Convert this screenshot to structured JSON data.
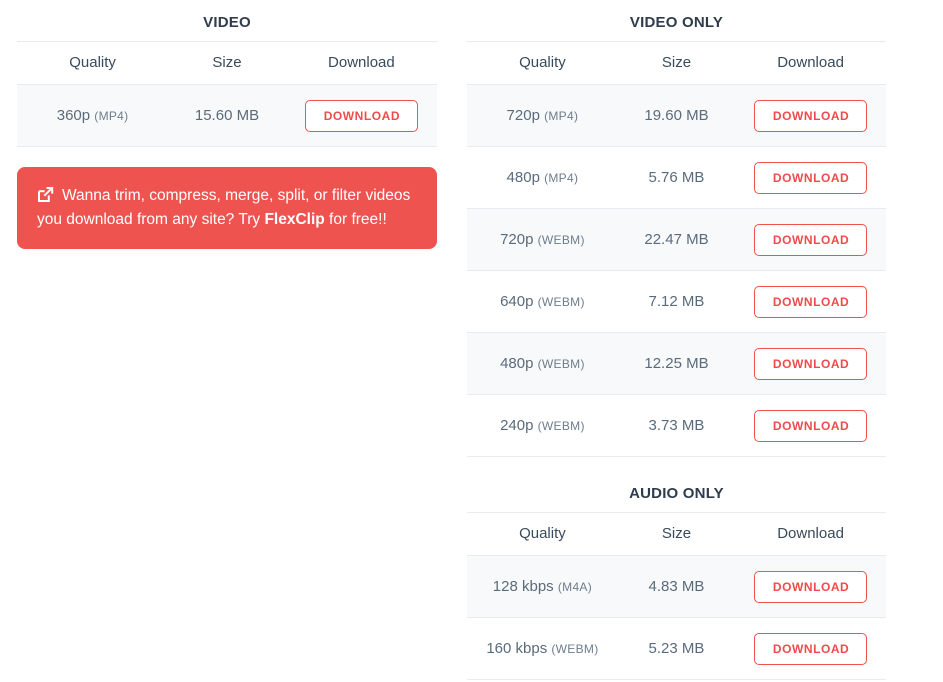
{
  "sections": {
    "video": {
      "title": "VIDEO",
      "columns": {
        "quality": "Quality",
        "size": "Size",
        "download": "Download"
      },
      "rows": [
        {
          "quality": "360p",
          "format": "(MP4)",
          "size": "15.60 MB",
          "button": "DOWNLOAD"
        }
      ]
    },
    "video_only": {
      "title": "VIDEO ONLY",
      "columns": {
        "quality": "Quality",
        "size": "Size",
        "download": "Download"
      },
      "rows": [
        {
          "quality": "720p",
          "format": "(MP4)",
          "size": "19.60 MB",
          "button": "DOWNLOAD"
        },
        {
          "quality": "480p",
          "format": "(MP4)",
          "size": "5.76 MB",
          "button": "DOWNLOAD"
        },
        {
          "quality": "720p",
          "format": "(WEBM)",
          "size": "22.47 MB",
          "button": "DOWNLOAD"
        },
        {
          "quality": "640p",
          "format": "(WEBM)",
          "size": "7.12 MB",
          "button": "DOWNLOAD"
        },
        {
          "quality": "480p",
          "format": "(WEBM)",
          "size": "12.25 MB",
          "button": "DOWNLOAD"
        },
        {
          "quality": "240p",
          "format": "(WEBM)",
          "size": "3.73 MB",
          "button": "DOWNLOAD"
        }
      ]
    },
    "audio_only": {
      "title": "AUDIO ONLY",
      "columns": {
        "quality": "Quality",
        "size": "Size",
        "download": "Download"
      },
      "rows": [
        {
          "quality": "128 kbps",
          "format": "(M4A)",
          "size": "4.83 MB",
          "button": "DOWNLOAD"
        },
        {
          "quality": "160 kbps",
          "format": "(WEBM)",
          "size": "5.23 MB",
          "button": "DOWNLOAD"
        }
      ]
    }
  },
  "promo": {
    "icon": "external-link-icon",
    "text_before": "Wanna trim, compress, merge, split, or filter videos you download from any site? Try ",
    "brand": "FlexClip",
    "text_after": " for free!!",
    "background_color": "#ef5350"
  },
  "colors": {
    "accent": "#ef4b4b",
    "heading": "#2f3c4c",
    "cell_text": "#5a6b7b",
    "row_stripe": "#f8f9fa",
    "border": "#e9ecef"
  }
}
